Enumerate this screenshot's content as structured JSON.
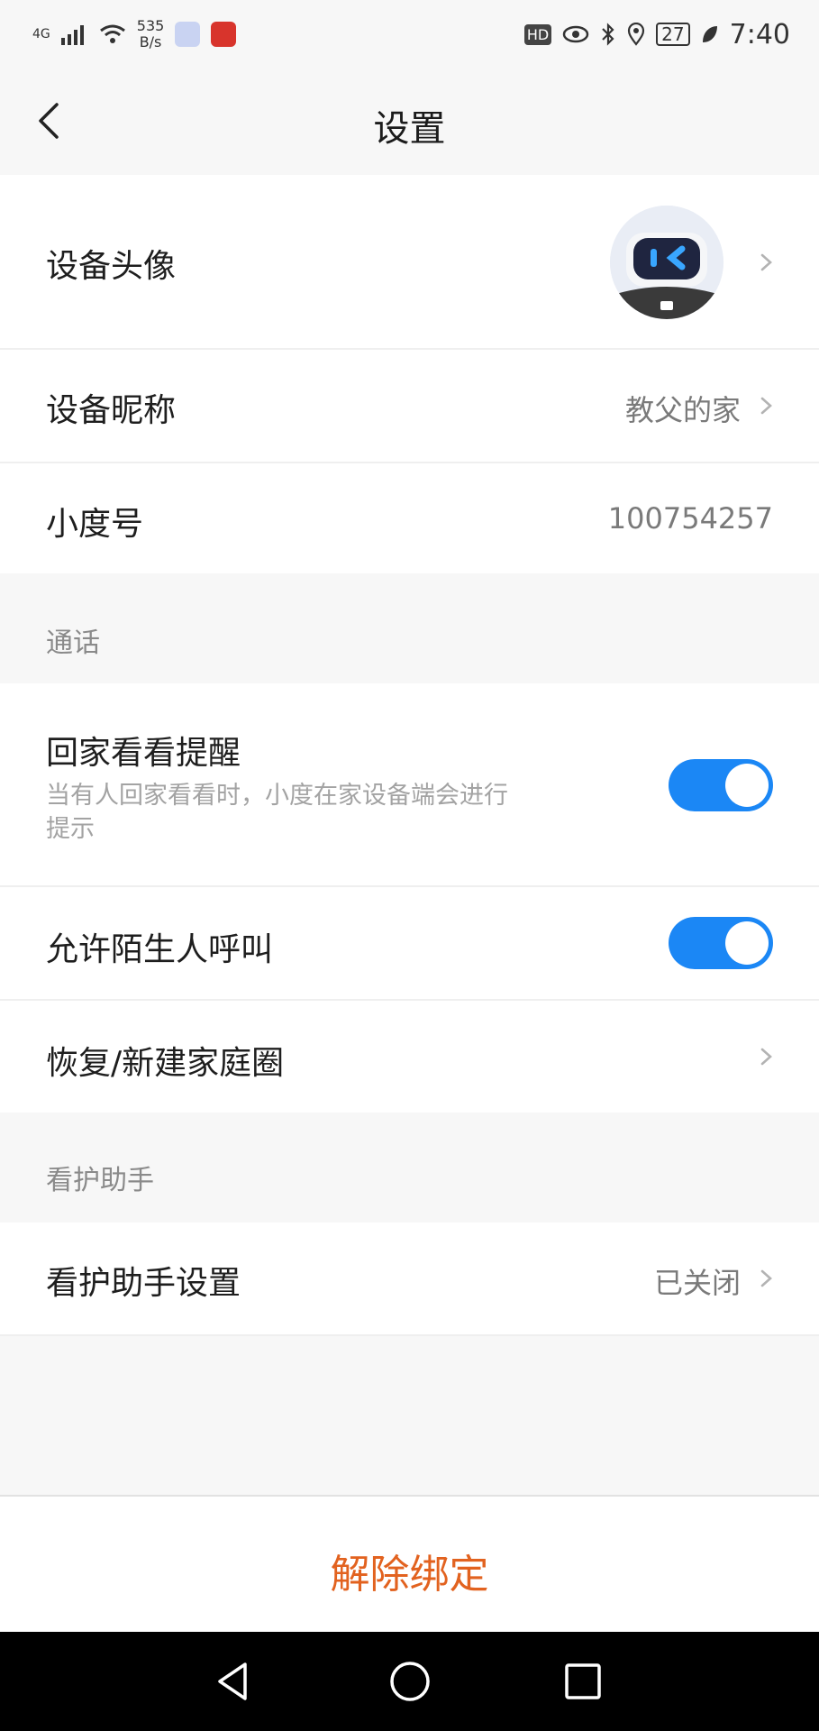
{
  "status_bar": {
    "network": "4G",
    "speed_value": "535",
    "speed_unit": "B/s",
    "hd": "HD",
    "battery": "27",
    "time": "7:40"
  },
  "nav": {
    "title": "设置",
    "back_icon": "chevron-left-icon"
  },
  "device": {
    "avatar_label": "设备头像",
    "nickname_label": "设备昵称",
    "nickname_value": "教父的家",
    "id_label": "小度号",
    "id_value": "100754257"
  },
  "call_section": {
    "header": "通话",
    "home_reminder_label": "回家看看提醒",
    "home_reminder_desc": "当有人回家看看时，小度在家设备端会进行提示",
    "home_reminder_on": true,
    "allow_strangers_label": "允许陌生人呼叫",
    "allow_strangers_on": true,
    "restore_family_label": "恢复/新建家庭圈"
  },
  "care_section": {
    "header": "看护助手",
    "settings_label": "看护助手设置",
    "settings_value": "已关闭"
  },
  "footer": {
    "unbind_label": "解除绑定"
  },
  "colors": {
    "toggle_on": "#1b87f5",
    "unbind_text": "#e2621f"
  }
}
